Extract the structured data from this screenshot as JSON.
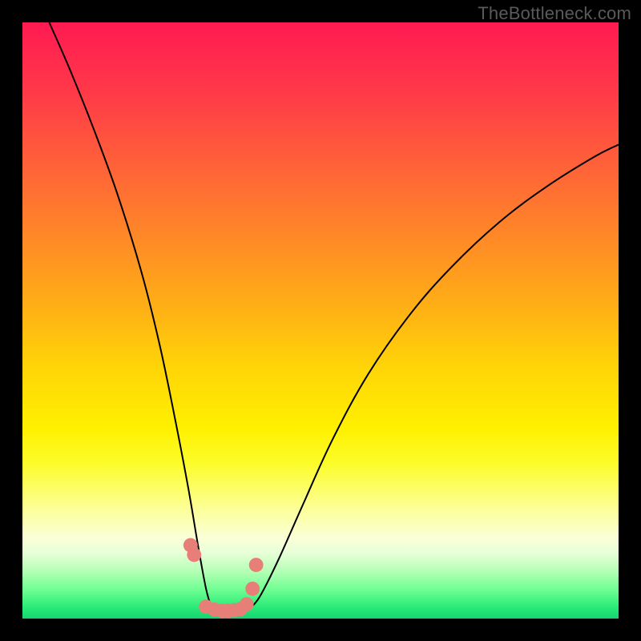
{
  "watermark": "TheBottleneck.com",
  "chart_data": {
    "type": "line",
    "title": "",
    "xlabel": "",
    "ylabel": "",
    "xlim": [
      0,
      100
    ],
    "ylim": [
      0,
      100
    ],
    "series": [
      {
        "name": "left-branch",
        "x": [
          4.5,
          8,
          12,
          16,
          20,
          23,
          25.5,
          27.8,
          29.5,
          30.8,
          31.8
        ],
        "values": [
          100,
          92,
          82,
          71,
          58,
          46,
          34,
          22,
          12,
          5,
          1.5
        ],
        "color": "#000000"
      },
      {
        "name": "right-branch",
        "x": [
          38.5,
          40,
          43,
          47,
          52,
          58,
          65,
          72,
          80,
          88,
          96,
          100
        ],
        "values": [
          2,
          4,
          10,
          19,
          30,
          41,
          51,
          59,
          66.5,
          72.5,
          77.5,
          79.5
        ],
        "color": "#000000"
      },
      {
        "name": "left-markers",
        "x": [
          28.2,
          28.8,
          30.8,
          32.2
        ],
        "values": [
          12.3,
          10.7,
          2.0,
          1.5
        ],
        "color": "#e77f78",
        "marker_radius": 1.2
      },
      {
        "name": "right-markers",
        "x": [
          33.5,
          34.5,
          35.5,
          36.6,
          37.6,
          38.6,
          39.2
        ],
        "values": [
          1.3,
          1.3,
          1.4,
          1.6,
          2.4,
          5.0,
          9.0
        ],
        "color": "#e77f78",
        "marker_radius": 1.2
      }
    ]
  }
}
